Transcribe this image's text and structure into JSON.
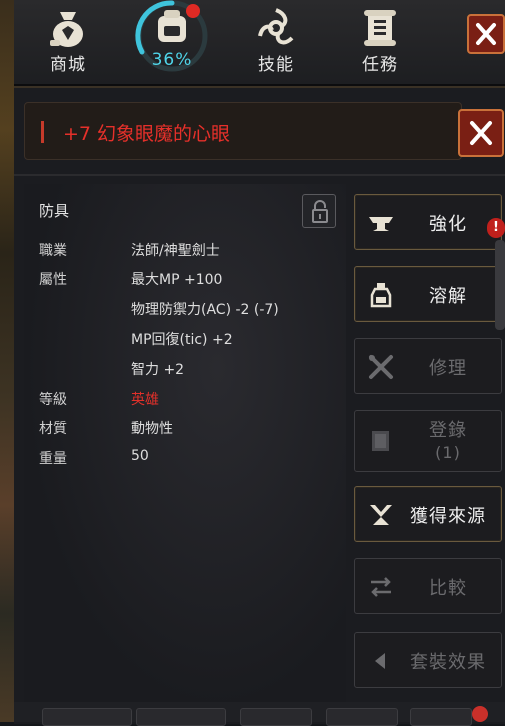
{
  "nav": {
    "items": [
      {
        "label": "商城",
        "icon": "bag-icon"
      },
      {
        "label": "36%",
        "icon": "pack-icon"
      },
      {
        "label": "技能",
        "icon": "skill-icon"
      },
      {
        "label": "任務",
        "icon": "scroll-icon"
      }
    ]
  },
  "item": {
    "title": "+7 幻象眼魔的心眼",
    "category": "防具",
    "stats": [
      {
        "label": "職業",
        "value": "法師/神聖劍士"
      },
      {
        "label": "屬性",
        "value": "最大MP +100"
      },
      {
        "label": "",
        "value": "物理防禦力(AC) -2 (-7)"
      },
      {
        "label": "",
        "value": "MP回復(tic) +2"
      },
      {
        "label": "",
        "value": "智力 +2"
      },
      {
        "label": "等級",
        "value": "英雄"
      },
      {
        "label": "材質",
        "value": "動物性"
      },
      {
        "label": "重量",
        "value": "50"
      }
    ]
  },
  "actions": {
    "enhance": "強化",
    "dissolve": "溶解",
    "repair": "修理",
    "register": "登錄",
    "register_count": "(1)",
    "source": "獲得來源",
    "compare": "比較",
    "set_effect": "套裝效果"
  },
  "alert_badge": "!",
  "colors": {
    "accent_red": "#e0302a",
    "progress_cyan": "#4fd4e8",
    "button_border": "#6a5a3e",
    "close_bg": "#7a1f14"
  },
  "inventory_progress": 0.36
}
